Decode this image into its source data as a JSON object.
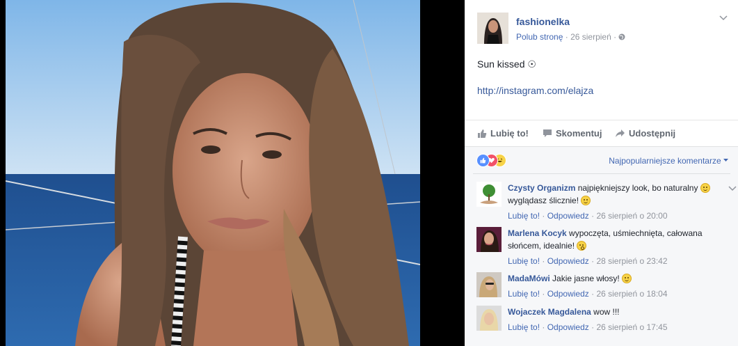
{
  "post": {
    "author": "fashionelka",
    "like_page": "Polub stronę",
    "dot": "·",
    "date": "26 sierpień",
    "text": "Sun kissed ☉",
    "link": "http://instagram.com/elajza"
  },
  "actions": {
    "like": "Lubię to!",
    "comment": "Skomentuj",
    "share": "Udostępnij"
  },
  "comments_section": {
    "sort_label": "Najpopularniejsze komentarze",
    "reactions": [
      "like",
      "love",
      "haha"
    ],
    "items": [
      {
        "name": "Czysty Organizm",
        "text_1": "najpiękniejszy look, bo naturalny",
        "text_2": "wyglądasz ślicznie!",
        "like": "Lubię to!",
        "reply": "Odpowiedz",
        "time": "26 sierpień o 20:00"
      },
      {
        "name": "Marlena Kocyk",
        "text_1": "wypoczęta, uśmiechnięta,",
        "text_2": "całowana słońcem, idealnie!",
        "like": "Lubię to!",
        "reply": "Odpowiedz",
        "time": "28 sierpień o 23:42"
      },
      {
        "name": "MadaMówi",
        "text_1": "Jakie jasne włosy!",
        "like": "Lubię to!",
        "reply": "Odpowiedz",
        "time": "26 sierpień o 18:04"
      },
      {
        "name": "Wojaczek Magdalena",
        "text_1": "wow !!!",
        "like": "Lubię to!",
        "reply": "Odpowiedz",
        "time": "26 sierpień o 17:45"
      }
    ]
  },
  "colors": {
    "link": "#365899",
    "accent": "#4267b2",
    "muted": "#90949c",
    "love": "#f25268",
    "like": "#5890ff"
  }
}
